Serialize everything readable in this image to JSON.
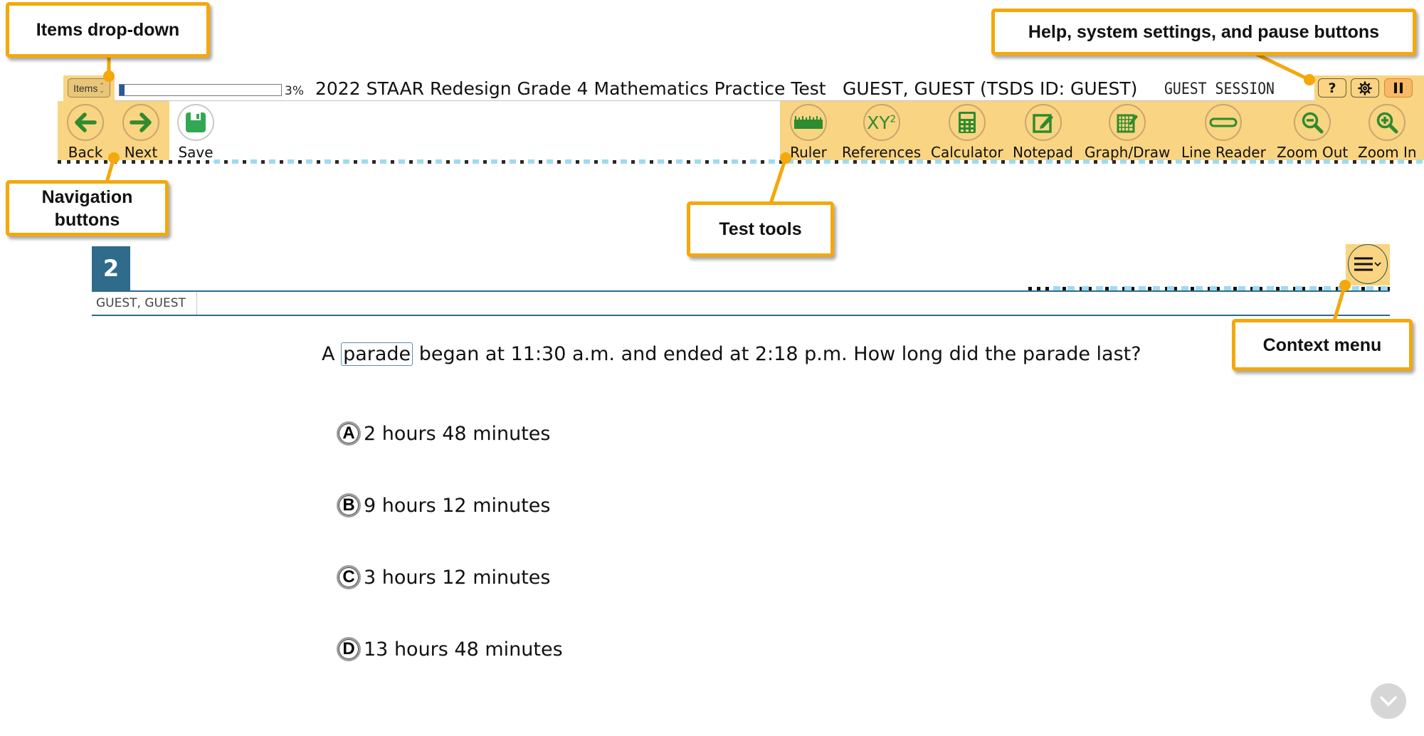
{
  "topbar": {
    "items_dropdown_label": "Items",
    "progress_percent": 3,
    "progress_label": "3%",
    "test_title": "2022 STAAR Redesign Grade 4 Mathematics Practice Test",
    "student_info": "GUEST, GUEST (TSDS ID: GUEST)",
    "session": "GUEST SESSION",
    "help_label": "?",
    "system_buttons": [
      "help-icon",
      "gear-icon",
      "pause-icon"
    ]
  },
  "navigation": [
    {
      "label": "Back",
      "icon": "arrow-left-icon"
    },
    {
      "label": "Next",
      "icon": "arrow-right-icon"
    },
    {
      "label": "Save",
      "icon": "floppy-disk-icon"
    }
  ],
  "tools": [
    {
      "label": "Ruler",
      "icon": "ruler-icon"
    },
    {
      "label": "References",
      "icon": "references-icon"
    },
    {
      "label": "Calculator",
      "icon": "calculator-icon"
    },
    {
      "label": "Notepad",
      "icon": "notepad-icon"
    },
    {
      "label": "Graph/Draw",
      "icon": "graph-draw-icon"
    },
    {
      "label": "Line Reader",
      "icon": "line-reader-icon"
    },
    {
      "label": "Zoom Out",
      "icon": "zoom-out-icon"
    },
    {
      "label": "Zoom In",
      "icon": "zoom-in-icon"
    }
  ],
  "references_glyph": {
    "base": "XY",
    "sup": "2"
  },
  "item": {
    "number": "2",
    "student_name": "GUEST, GUEST",
    "question_prefix": "A",
    "glossary_word": "parade",
    "question_rest": "began at 11:30 a.m. and ended at 2:18 p.m. How long did the parade last?",
    "choices": [
      {
        "letter": "A",
        "text": "2 hours 48 minutes"
      },
      {
        "letter": "B",
        "text": "9 hours 12 minutes"
      },
      {
        "letter": "C",
        "text": "3 hours 12 minutes"
      },
      {
        "letter": "D",
        "text": "13 hours 48 minutes"
      }
    ]
  },
  "callouts": {
    "items_dropdown": "Items drop-down",
    "system_buttons": "Help, system settings, and pause buttons",
    "navigation": "Navigation buttons",
    "test_tools": "Test tools",
    "context_menu": "Context menu"
  },
  "colors": {
    "highlight": "#f9d482",
    "callout_border": "#f4a80c",
    "item_header": "#2f6b8a",
    "icon_green": "#2e8b2e",
    "progress_fill": "#2a5a9a"
  }
}
